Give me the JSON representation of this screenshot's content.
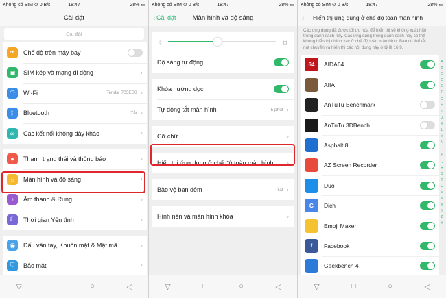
{
  "screens": [
    {
      "status": {
        "carrier": "Không có SIM ⊙ 0 B/s",
        "time": "18:47",
        "battery": "28% ▭"
      },
      "title": "Cài đặt",
      "search_placeholder": "Cài đặt",
      "groups": [
        [
          {
            "label": "Chế độ trên máy bay",
            "icon": "airplane-icon",
            "color": "#f5a623",
            "toggle": false
          },
          {
            "label": "SIM kép và mạng di động",
            "icon": "sim-icon",
            "color": "#32b86b"
          },
          {
            "label": "Wi-Fi",
            "icon": "wifi-icon",
            "color": "#3b8ee8",
            "value": "Tenda_705EB0"
          },
          {
            "label": "Bluetooth",
            "icon": "bluetooth-icon",
            "color": "#3b8ee8",
            "value": "Tắt"
          },
          {
            "label": "Các kết nối không dây khác",
            "icon": "link-icon",
            "color": "#2fb6b0"
          }
        ],
        [
          {
            "label": "Thanh trạng thái và thông báo",
            "icon": "notification-icon",
            "color": "#f05a4a"
          },
          {
            "label": "Màn hình và độ sáng",
            "icon": "brightness-icon",
            "color": "#f5b82e"
          },
          {
            "label": "Âm thanh & Rung",
            "icon": "sound-icon",
            "color": "#9b59d0"
          },
          {
            "label": "Thời gian Yên tĩnh",
            "icon": "moon-icon",
            "color": "#7b68d8"
          }
        ],
        [
          {
            "label": "Dấu vân tay, Khuôn mặt & Mật mã",
            "icon": "fingerprint-icon",
            "color": "#4aa3e8"
          },
          {
            "label": "Bảo mật",
            "icon": "shield-icon",
            "color": "#2f9ae0"
          }
        ]
      ]
    },
    {
      "status": {
        "carrier": "Không có SIM ⊙ 0 B/s",
        "time": "18:47",
        "battery": "28% ▭"
      },
      "back_label": "Cài đặt",
      "title": "Màn hình và độ sáng",
      "brightness_level": 0.46,
      "auto_brightness": "Độ sáng tự động",
      "orientation_lock": "Khóa hướng dọc",
      "auto_lock": {
        "label": "Tự động tắt màn hình",
        "value": "5 phút"
      },
      "font_size": "Cỡ chữ",
      "fullscreen": "Hiển thị ứng dụng ở chế độ toàn màn hình",
      "night_shield": {
        "label": "Bảo vệ ban đêm",
        "value": "Tắt"
      },
      "wallpaper": "Hình nền và màn hình khóa"
    },
    {
      "status": {
        "carrier": "Không có SIM ⊙ 0 B/s",
        "time": "18:47",
        "battery": "28% ▭"
      },
      "title": "Hiển thị ứng dụng ở chế độ toàn màn hình",
      "description": "Các ứng dụng đã được tối ưu hóa để hiển thị sẽ không xuất hiện trong danh sách này. Các ứng dụng trong danh sách này có thể không hiển thị chính xác ở chế độ toàn màn hình. Bạn có thể tắt nút chuyển và hiển thị các nội dung này ở tỷ lệ 16:9.",
      "apps": [
        {
          "name": "AIDA64",
          "icon": "aida64-icon",
          "color": "#c0151b",
          "glyph": "64",
          "on": true
        },
        {
          "name": "AIIA",
          "icon": "aiia-icon",
          "color": "#7a5a3a",
          "glyph": "",
          "on": true
        },
        {
          "name": "AnTuTu Benchmark",
          "icon": "antutu-icon",
          "color": "#222222",
          "glyph": "",
          "on": false
        },
        {
          "name": "AnTuTu 3DBench",
          "icon": "antutu-3d-icon",
          "color": "#1a1a1a",
          "glyph": "",
          "on": false
        },
        {
          "name": "Asphalt 8",
          "icon": "asphalt-icon",
          "color": "#1f6fd1",
          "glyph": "",
          "on": true
        },
        {
          "name": "AZ Screen Recorder",
          "icon": "az-recorder-icon",
          "color": "#e84b3c",
          "glyph": "",
          "on": true
        },
        {
          "name": "Duo",
          "icon": "duo-icon",
          "color": "#1e8fe8",
          "glyph": "",
          "on": true
        },
        {
          "name": "Dịch",
          "icon": "translate-icon",
          "color": "#4a86e8",
          "glyph": "G",
          "on": true
        },
        {
          "name": "Emoji Maker",
          "icon": "emoji-icon",
          "color": "#f5c232",
          "glyph": "",
          "on": true
        },
        {
          "name": "Facebook",
          "icon": "facebook-icon",
          "color": "#3b5998",
          "glyph": "f",
          "on": true
        },
        {
          "name": "Geekbench 4",
          "icon": "geekbench-icon",
          "color": "#2d7bd8",
          "glyph": "",
          "on": true
        }
      ],
      "alphabet": [
        "A",
        "B",
        "C",
        "D",
        "E",
        "F",
        "G",
        "H",
        "I",
        "J",
        "K",
        "L",
        "M",
        "N",
        "O",
        "P",
        "Q",
        "R",
        "S",
        "T",
        "U",
        "V",
        "W",
        "X",
        "Y",
        "Z",
        "#"
      ]
    }
  ],
  "nav": {
    "menu": "▽",
    "home": "○",
    "recent": "□",
    "back": "◁"
  }
}
